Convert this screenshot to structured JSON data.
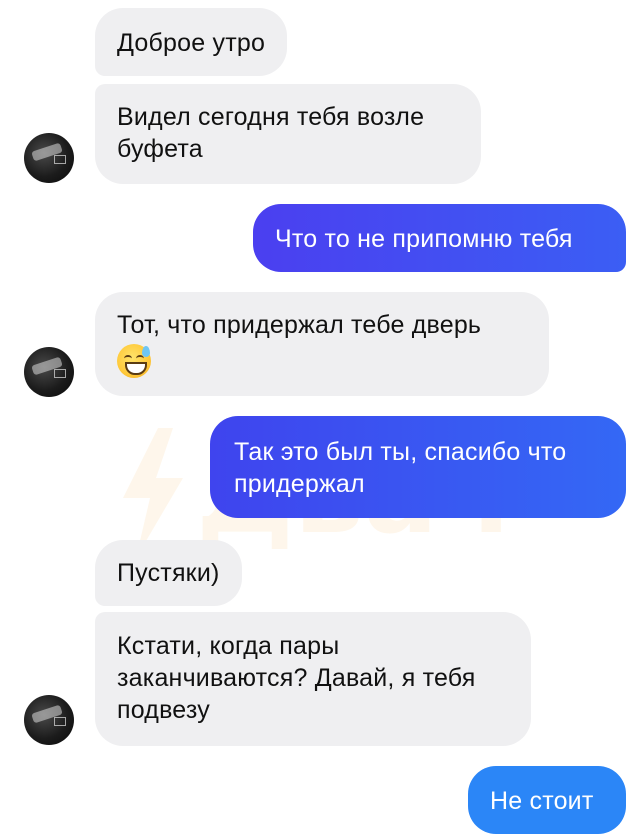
{
  "watermark": {
    "text": "Двач"
  },
  "messages": [
    {
      "dir": "in",
      "text": "Доброе утро"
    },
    {
      "dir": "in",
      "lines": [
        "Видел сегодня тебя возле",
        "буфета"
      ]
    },
    {
      "dir": "out",
      "text": "Что то не припомню тебя"
    },
    {
      "dir": "in",
      "text": "Тот, что придержал тебе дверь",
      "emoji": "sweat-smile-emoji"
    },
    {
      "dir": "out",
      "lines": [
        "Так это был ты, спасибо что",
        "придержал"
      ]
    },
    {
      "dir": "in",
      "text": "Пустяки)"
    },
    {
      "dir": "in",
      "lines": [
        "Кстати, когда пары",
        "заканчиваются? Давай, я тебя",
        "подвезу"
      ]
    },
    {
      "dir": "out",
      "text": "Не стоит"
    }
  ],
  "colors": {
    "incoming_bubble": "#efeff1",
    "outgoing_gradient_start": "#3d45f0",
    "outgoing_gradient_end": "#2f73f5",
    "outgoing_last": "#2b86f7"
  }
}
